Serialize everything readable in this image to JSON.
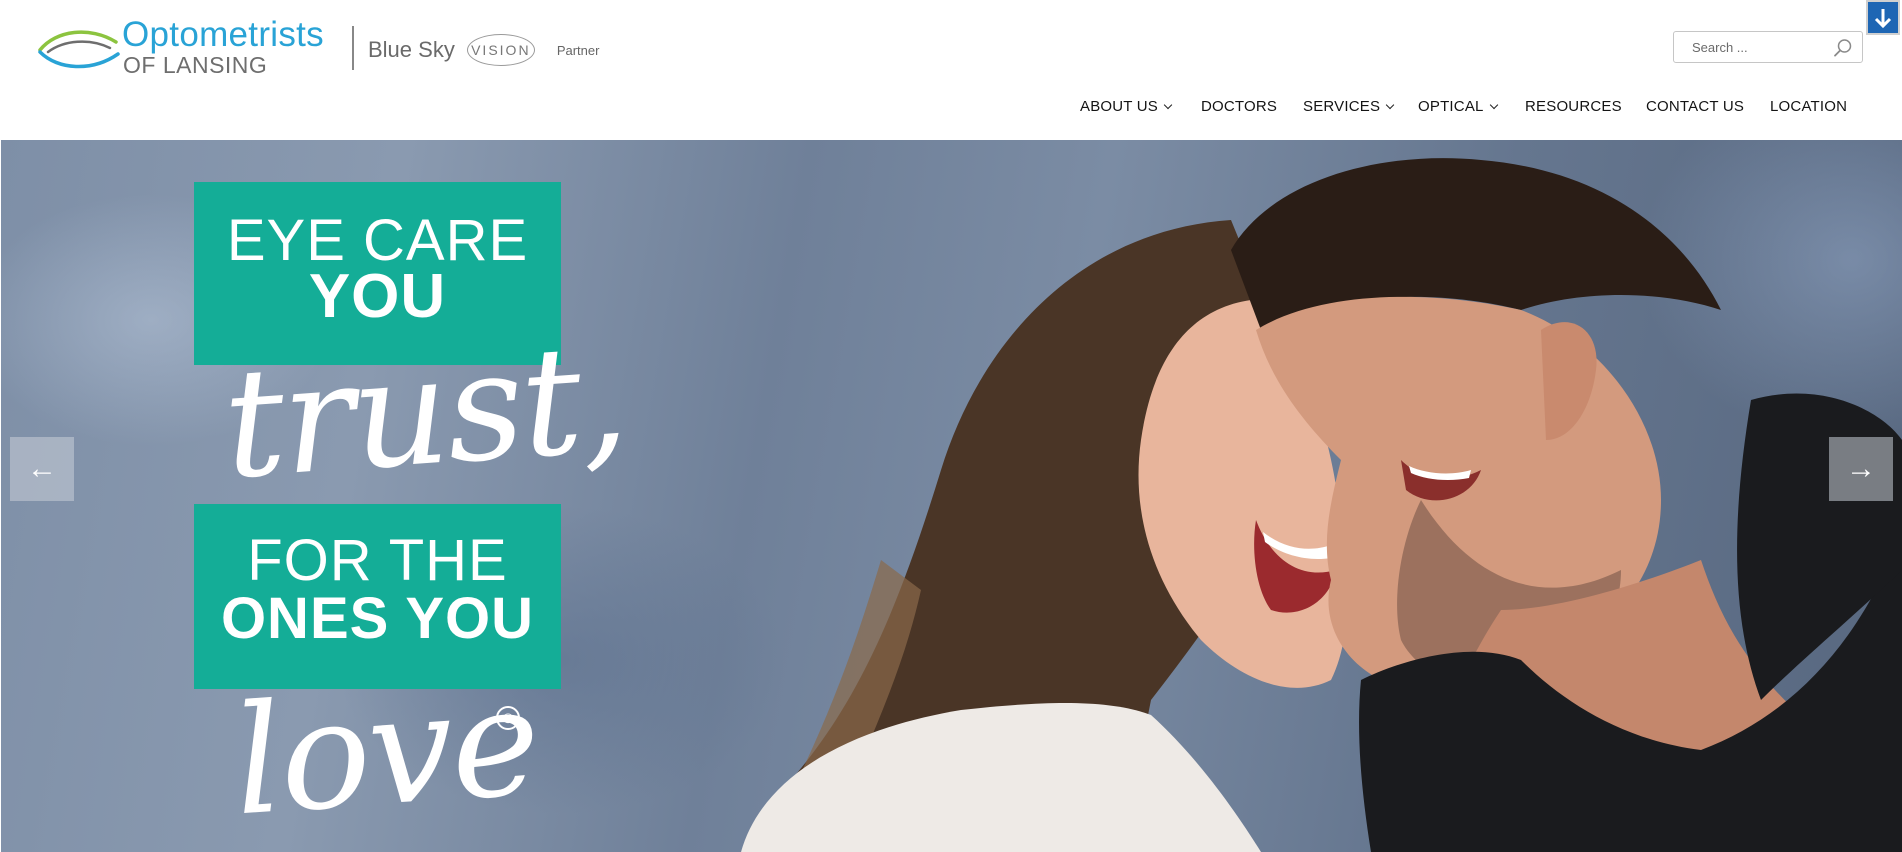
{
  "header": {
    "logo": {
      "title": "Optometrists",
      "subtitle": "OF LANSING"
    },
    "partner": {
      "name": "Blue Sky",
      "badge": "VISION",
      "label": "Partner"
    },
    "search": {
      "placeholder": "Search ...",
      "value": ""
    }
  },
  "nav": {
    "items": [
      {
        "label": "ABOUT US",
        "has_dropdown": true
      },
      {
        "label": "DOCTORS",
        "has_dropdown": false
      },
      {
        "label": "SERVICES",
        "has_dropdown": true
      },
      {
        "label": "OPTICAL",
        "has_dropdown": true
      },
      {
        "label": "RESOURCES",
        "has_dropdown": false
      },
      {
        "label": "CONTACT US",
        "has_dropdown": false
      },
      {
        "label": "LOCATION",
        "has_dropdown": false
      }
    ]
  },
  "hero": {
    "line1": "EYE CARE",
    "line2": "YOU",
    "script1": "trust,",
    "line3": "FOR THE",
    "line4": "ONES YOU",
    "script2": "love",
    "registered": "®",
    "prev_arrow": "←",
    "next_arrow": "→"
  },
  "colors": {
    "brand_blue": "#29a3d6",
    "brand_gray": "#6e6e6e",
    "teal": "#14ad97",
    "scroll_button": "#1e66b4"
  },
  "icons": [
    "eye-logo-icon",
    "search-icon",
    "arrow-down-icon",
    "chevron-down-icon",
    "arrow-left-icon",
    "arrow-right-icon"
  ]
}
